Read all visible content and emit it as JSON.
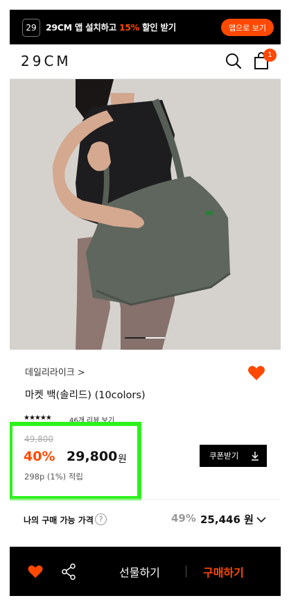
{
  "banner": {
    "badge": "29",
    "text_prefix": "29CM 앱 설치하고 ",
    "text_highlight": "15%",
    "text_suffix": " 할인 받기",
    "button_label": "앱으로 보기"
  },
  "header": {
    "logo": "29CM",
    "cart_count": "1"
  },
  "product": {
    "brand_link": "데일리라이크 >",
    "title": "마켓 백(솔리드) (10colors)",
    "rating_stars": "★★★★★",
    "rating": 4.5,
    "review_count": "46개 리뷰 보기",
    "original_price": "49,800",
    "discount_rate": "40%",
    "sale_price": "29,800",
    "currency": "원",
    "point_info": "298p (1%) 적립",
    "coupon_label": "쿠폰받기",
    "image_page": 1
  },
  "my_price": {
    "label": "나의 구매 가능 가격",
    "help": "?",
    "rate": "49%",
    "value": "25,446 원"
  },
  "bottom_bar": {
    "gift_label": "선물하기",
    "buy_label": "구매하기"
  },
  "colors": {
    "accent": "#ff4800",
    "highlight_box": "#2cf21c"
  }
}
